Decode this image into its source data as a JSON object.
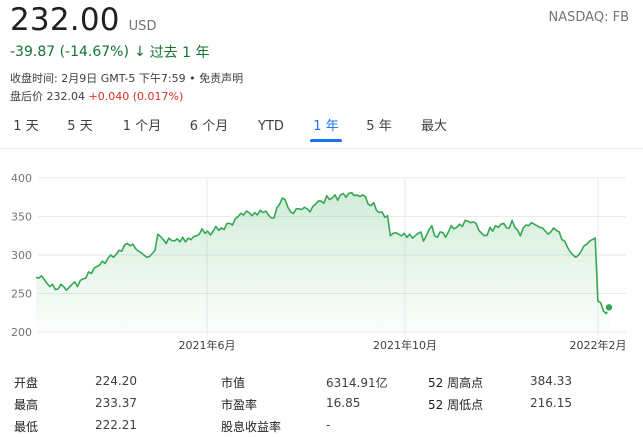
{
  "quote": {
    "price": "232.00",
    "currency": "USD",
    "exchange": "NASDAQ: FB",
    "change": "-39.87 (-14.67%)",
    "change_arrow": "↓",
    "period": "过去 1 年",
    "closed_line": "收盘时间: 2月9日 GMT-5 下午7:59 • 免责声明",
    "after_hours_label": "盘后价",
    "after_hours_price": "232.04",
    "after_hours_delta": "+0.040 (0.017%)",
    "colors": {
      "positive": "#137333",
      "negative": "#d93025",
      "accent": "#1a73e8",
      "line": "#34a853"
    }
  },
  "tabs": [
    {
      "label": "1 天",
      "active": false
    },
    {
      "label": "5 天",
      "active": false
    },
    {
      "label": "1 个月",
      "active": false
    },
    {
      "label": "6 个月",
      "active": false
    },
    {
      "label": "YTD",
      "active": false
    },
    {
      "label": "1 年",
      "active": true
    },
    {
      "label": "5 年",
      "active": false
    },
    {
      "label": "最大",
      "active": false
    }
  ],
  "chart_data": {
    "type": "area",
    "ylim": [
      200,
      400
    ],
    "yticks": [
      "400",
      "350",
      "300",
      "250",
      "200"
    ],
    "xticks": [
      "2021年6月",
      "2021年10月",
      "2022年2月"
    ],
    "xlabel": "",
    "ylabel": "",
    "grid": true,
    "series": [
      {
        "values": [
          271,
          270,
          273,
          268,
          263,
          259,
          262,
          255,
          256,
          262,
          259,
          254,
          258,
          262,
          265,
          259,
          267,
          269,
          270,
          278,
          276,
          283,
          285,
          287,
          292,
          289,
          296,
          300,
          297,
          301,
          306,
          305,
          313,
          315,
          312,
          314,
          308,
          305,
          303,
          300,
          297,
          298,
          302,
          306,
          327,
          324,
          320,
          315,
          322,
          319,
          318,
          321,
          317,
          323,
          317,
          322,
          320,
          324,
          325,
          327,
          334,
          328,
          331,
          326,
          331,
          337,
          332,
          335,
          333,
          341,
          341,
          339,
          347,
          350,
          354,
          352,
          357,
          355,
          351,
          355,
          352,
          358,
          355,
          357,
          352,
          348,
          348,
          361,
          366,
          374,
          372,
          362,
          356,
          354,
          360,
          360,
          359,
          362,
          360,
          356,
          363,
          366,
          370,
          370,
          367,
          377,
          372,
          374,
          378,
          371,
          378,
          380,
          375,
          380,
          381,
          377,
          378,
          376,
          378,
          376,
          366,
          364,
          368,
          358,
          355,
          356,
          349,
          351,
          325,
          328,
          329,
          327,
          325,
          328,
          323,
          327,
          322,
          325,
          328,
          330,
          318,
          325,
          333,
          338,
          325,
          323,
          330,
          329,
          323,
          330,
          338,
          334,
          336,
          340,
          337,
          345,
          344,
          342,
          343,
          341,
          332,
          328,
          325,
          326,
          336,
          331,
          338,
          336,
          340,
          341,
          335,
          335,
          345,
          336,
          332,
          325,
          335,
          339,
          338,
          342,
          340,
          338,
          336,
          335,
          331,
          327,
          330,
          335,
          332,
          330,
          320,
          318,
          310,
          304,
          300,
          297,
          300,
          305,
          312,
          314,
          318,
          320,
          322,
          240,
          238,
          227,
          224,
          232
        ]
      }
    ]
  },
  "stats": [
    {
      "label": "开盘",
      "value": "224.20"
    },
    {
      "label": "最高",
      "value": "233.37"
    },
    {
      "label": "最低",
      "value": "222.21"
    },
    {
      "label": "市值",
      "value": "6314.91亿"
    },
    {
      "label": "市盈率",
      "value": "16.85"
    },
    {
      "label": "股息收益率",
      "value": "-"
    },
    {
      "label": "52 周高点",
      "value": "384.33"
    },
    {
      "label": "52 周低点",
      "value": "216.15"
    }
  ]
}
